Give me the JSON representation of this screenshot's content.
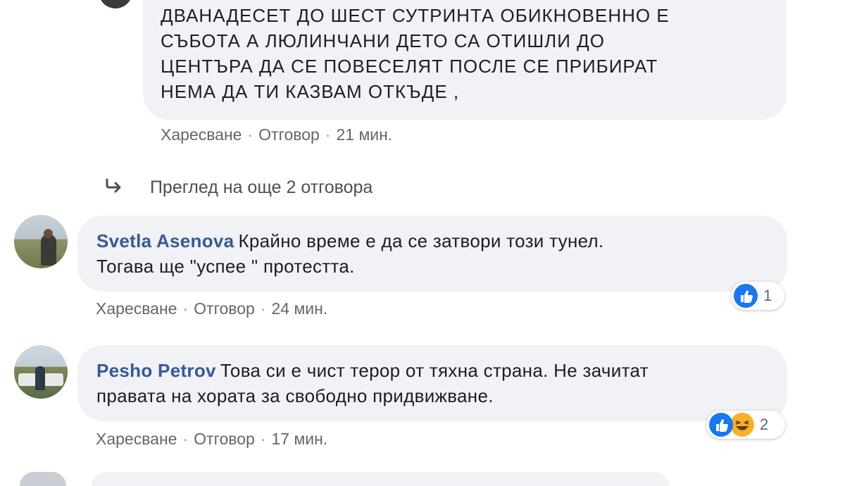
{
  "comments": [
    {
      "text_lines": [
        "ДВАНАДЕСЕТ ДО ШЕСТ СУТРИНТА ОБИКНОВЕННО Е",
        "СЪБОТА А ЛЮЛИНЧАНИ ДЕТО СА ОТИШЛИ ДО",
        "ЦЕНТЪРА ДА СЕ ПОВЕСЕЛЯТ ПОСЛЕ СЕ ПРИБИРАТ",
        "НЕМА ДА ТИ КАЗВАМ ОТКЪДЕ ,"
      ],
      "like_label": "Харесване",
      "reply_label": "Отговор",
      "time": "21 мин."
    },
    {
      "author": "Svetla Asenova",
      "text_line1": "Крайно време е да се затвори този тунел.",
      "text_line2": "Тогава ще \"успее \" протестта.",
      "like_label": "Харесване",
      "reply_label": "Отговор",
      "time": "24 мин.",
      "reaction_count": "1",
      "reaction_icons": [
        "like-icon"
      ]
    },
    {
      "author": "Pesho Petrov",
      "text_line1": "Това си е чист терор от тяхна страна. Не зачитат",
      "text_line2": "правата на хората за свободно придвижване.",
      "like_label": "Харесване",
      "reply_label": "Отговор",
      "time": "17 мин.",
      "reaction_count": "2",
      "reaction_icons": [
        "like-icon",
        "haha-icon"
      ]
    }
  ],
  "view_replies": {
    "label": "Преглед на още 2 отговора",
    "icon": "reply-arrow-icon"
  },
  "colors": {
    "bubble": "#f0f2f5",
    "author": "#385898",
    "meta": "#606770",
    "like_blue": "#1877f2",
    "haha_yellow": "#f7b125"
  }
}
